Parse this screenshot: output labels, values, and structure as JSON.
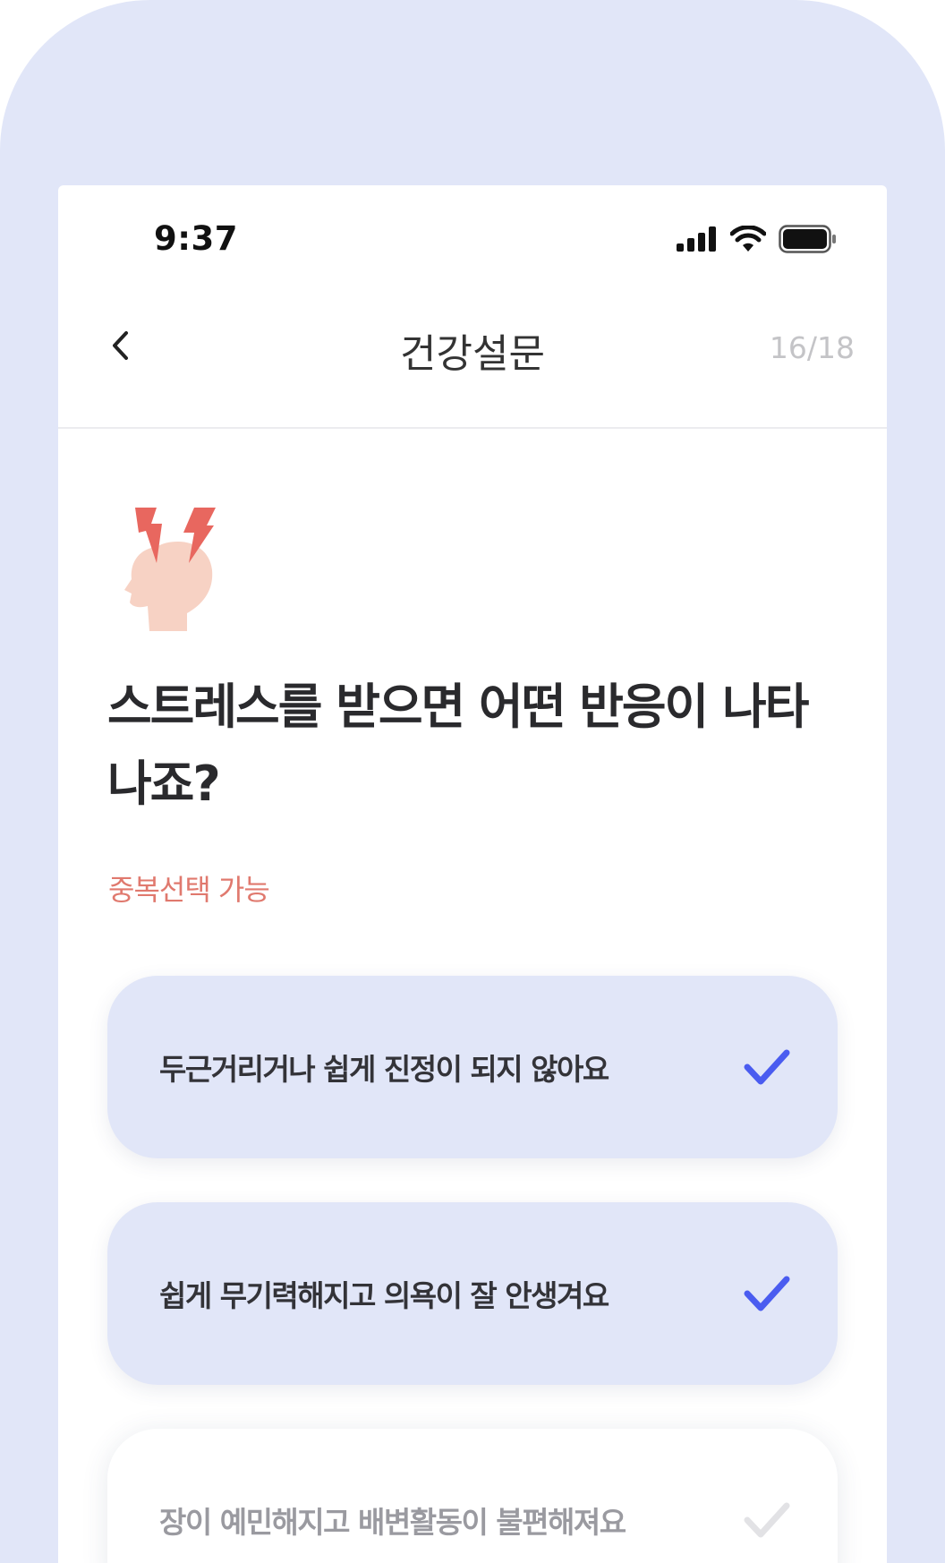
{
  "status_bar": {
    "time": "9:37",
    "icons": [
      "cellular-signal-icon",
      "wifi-icon",
      "battery-icon"
    ]
  },
  "nav": {
    "back_icon": "chevron-left-icon",
    "title": "건강설문",
    "progress": "16/18"
  },
  "question": {
    "illustration": "stressed-head-icon",
    "title": "스트레스를 받으면 어떤 반응이 나타나죠?",
    "hint": "중복선택 가능"
  },
  "options": [
    {
      "label": "두근거리거나 쉽게 진정이 되지 않아요",
      "selected": true
    },
    {
      "label": "쉽게 무기력해지고 의욕이 잘 안생겨요",
      "selected": true
    },
    {
      "label": "장이 예민해지고 배변활동이 불편해져요",
      "selected": false
    }
  ],
  "colors": {
    "frame_background": "#e1e6f8",
    "selected_option_background": "#e1e6f8",
    "check_selected": "#4a5cf0",
    "check_unselected": "#e2e2e5",
    "hint_text": "#e0796e",
    "lightning": "#e8675f",
    "head": "#f7d2c4"
  }
}
